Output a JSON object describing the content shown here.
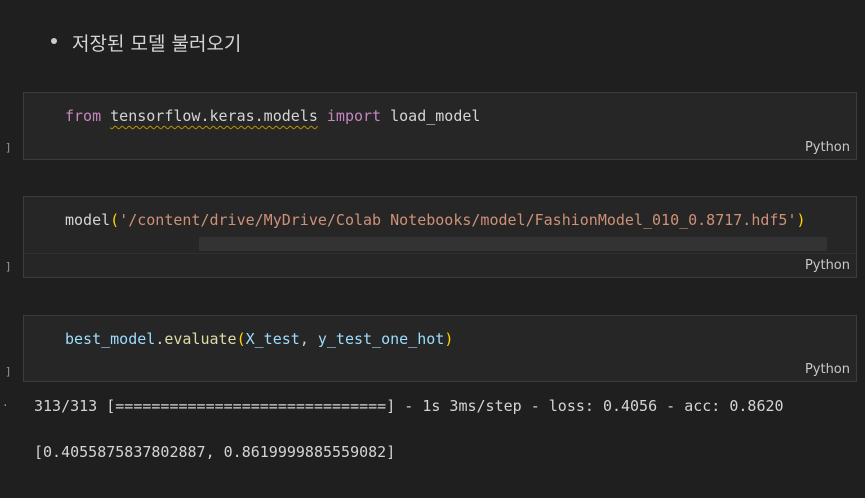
{
  "markdown": {
    "bullet_text": "저장된 모델 불러오기"
  },
  "cells": [
    {
      "language": "Python",
      "code": {
        "kw_from": "from",
        "module": "tensorflow.keras.models",
        "kw_import": "import",
        "name": "load_model"
      }
    },
    {
      "language": "Python",
      "code": {
        "func": "model",
        "open": "(",
        "string": "'/content/drive/MyDrive/Colab Notebooks/model/FashionModel_010_0.8717.hdf5'",
        "close": ")"
      }
    },
    {
      "language": "Python",
      "code": {
        "var": "best_model",
        "dot": ".",
        "method": "evaluate",
        "open": "(",
        "arg1": "X_test",
        "comma": ", ",
        "arg2": "y_test_one_hot",
        "close": ")"
      }
    }
  ],
  "brackets": {
    "exec": "]",
    "output": "·"
  },
  "output": {
    "progress_line": "313/313 [==============================] - 1s 3ms/step - loss: 0.4056 - acc: 0.8620",
    "result_line": "[0.4055875837802887, 0.8619999885559082]"
  },
  "colors": {
    "background": "#1f1f1f",
    "cell_bg": "#262626",
    "keyword": "#c586c0",
    "function": "#dcdcaa",
    "variable": "#9cdcfe",
    "string": "#ce9178",
    "bracket": "#ffd700"
  }
}
